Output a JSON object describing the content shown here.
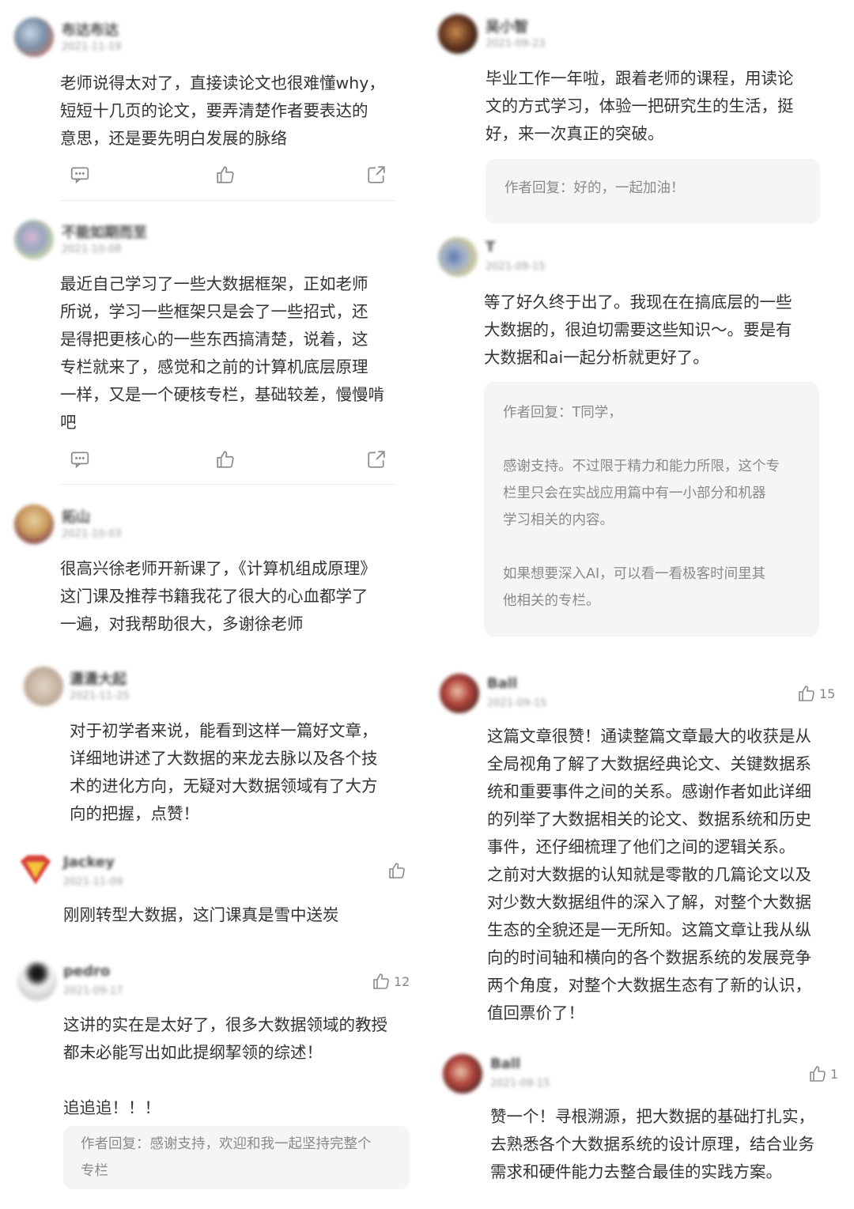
{
  "colors": {
    "background": "#ffffff",
    "text": "#333333",
    "muted": "#9a9a9a",
    "reply_bg": "#f4f5f7",
    "icon": "#8a8a8a"
  },
  "left": [
    {
      "author": "布达布达",
      "date": "2021-11-19",
      "text": "老师说得太对了，直接读论文也很难懂why，\n短短十几页的论文，要弄清楚作者要表达的\n意思，还是要先明白发展的脉络",
      "icons": [
        "comment-icon",
        "thumbs-up-icon",
        "share-icon"
      ]
    },
    {
      "author": "不能如期而至",
      "date": "2021-10-08",
      "text": "最近自己学习了一些大数据框架，正如老师\n所说，学习一些框架只是会了一些招式，还\n是得把更核心的一些东西搞清楚，说着，这\n专栏就来了，感觉和之前的计算机底层原理\n一样，又是一个硬核专栏，基础较差，慢慢啃\n吧",
      "icons": [
        "comment-icon",
        "thumbs-up-icon",
        "share-icon"
      ]
    },
    {
      "author": "拓山",
      "date": "2021-10-03",
      "text": "很高兴徐老师开新课了，《计算机组成原理》\n这门课及推荐书籍我花了很大的心血都学了\n一遍，对我帮助很大，多谢徐老师"
    },
    {
      "author": "潇潇大起",
      "date": "2021-11-25",
      "text": "对于初学者来说，能看到这样一篇好文章，\n详细地讲述了大数据的来龙去脉以及各个技\n术的进化方向，无疑对大数据领域有了大方\n向的把握，点赞！"
    },
    {
      "author": "Jackey",
      "date": "2021-11-09",
      "text": "刚刚转型大数据，这门课真是雪中送炭",
      "like_count": ""
    },
    {
      "author": "pedro",
      "date": "2021-09-17",
      "text": "这讲的实在是太好了，很多大数据领域的教授\n都未必能写出如此提纲挈领的综述！\n\n追追追！！！",
      "like_count": "12",
      "reply": "作者回复：感谢支持，欢迎和我一起坚持完整个\n专栏"
    }
  ],
  "right": [
    {
      "author": "吴小智",
      "date": "2021-09-23",
      "text": "毕业工作一年啦，跟着老师的课程，用读论\n文的方式学习，体验一把研究生的生活，挺\n好，来一次真正的突破。",
      "reply": "作者回复：好的，一起加油！"
    },
    {
      "author": "T",
      "date": "2021-09-15",
      "text": "等了好久终于出了。我现在在搞底层的一些\n大数据的，很迫切需要这些知识～。要是有\n大数据和ai一起分析就更好了。",
      "reply": "作者回复：T同学，\n\n感谢支持。不过限于精力和能力所限，这个专\n栏里只会在实战应用篇中有一小部分和机器\n学习相关的内容。\n\n如果想要深入AI，可以看一看极客时间里其\n他相关的专栏。"
    },
    {
      "author": "Ball",
      "date": "2021-09-15",
      "like_count": "15",
      "text": "这篇文章很赞！通读整篇文章最大的收获是从\n全局视角了解了大数据经典论文、关键数据系\n统和重要事件之间的关系。感谢作者如此详细\n的列举了大数据相关的论文、数据系统和历史\n事件，还仔细梳理了他们之间的逻辑关系。\n之前对大数据的认知就是零散的几篇论文以及\n对少数大数据组件的深入了解，对整个大数据\n生态的全貌还是一无所知。这篇文章让我从纵\n向的时间轴和横向的各个数据系统的发展竞争\n两个角度，对整个大数据生态有了新的认识，\n值回票价了！"
    },
    {
      "author": "Ball",
      "date": "2021-09-15",
      "like_count": "1",
      "text": "赞一个！寻根溯源，把大数据的基础打扎实，\n去熟悉各个大数据系统的设计原理，结合业务\n需求和硬件能力去整合最佳的实践方案。"
    }
  ]
}
